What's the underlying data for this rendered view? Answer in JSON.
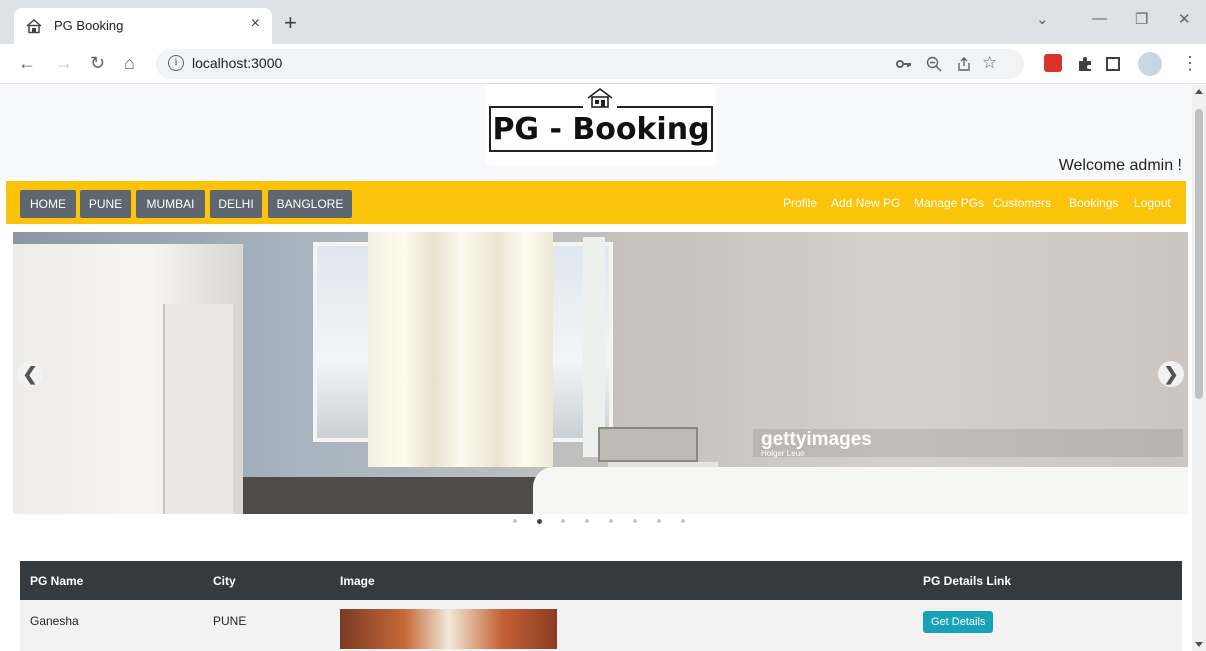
{
  "browser": {
    "tab_title": "PG Booking",
    "tab_close": "×",
    "new_tab": "+",
    "url": "localhost:3000",
    "info_icon": "i"
  },
  "site": {
    "logo_text": "PG - Booking",
    "welcome": "Welcome admin !"
  },
  "nav": {
    "buttons": [
      "HOME",
      "PUNE",
      "MUMBAI",
      "DELHI",
      "BANGLORE"
    ],
    "links": [
      "Profile",
      "Add New PG",
      "Manage PGs",
      "Customers",
      "Bookings",
      "Logout"
    ],
    "accent": "#fcc30b"
  },
  "carousel": {
    "watermark": "gettyimages",
    "watermark_credit": "Holger Leue",
    "prev_glyph": "❮",
    "next_glyph": "❯",
    "slide_count": 8,
    "active_index": 1
  },
  "table": {
    "headers": [
      "PG Name",
      "City",
      "Image",
      "PG Details Link"
    ],
    "rows": [
      {
        "name": "Ganesha",
        "city": "PUNE",
        "action": "Get Details"
      }
    ]
  }
}
